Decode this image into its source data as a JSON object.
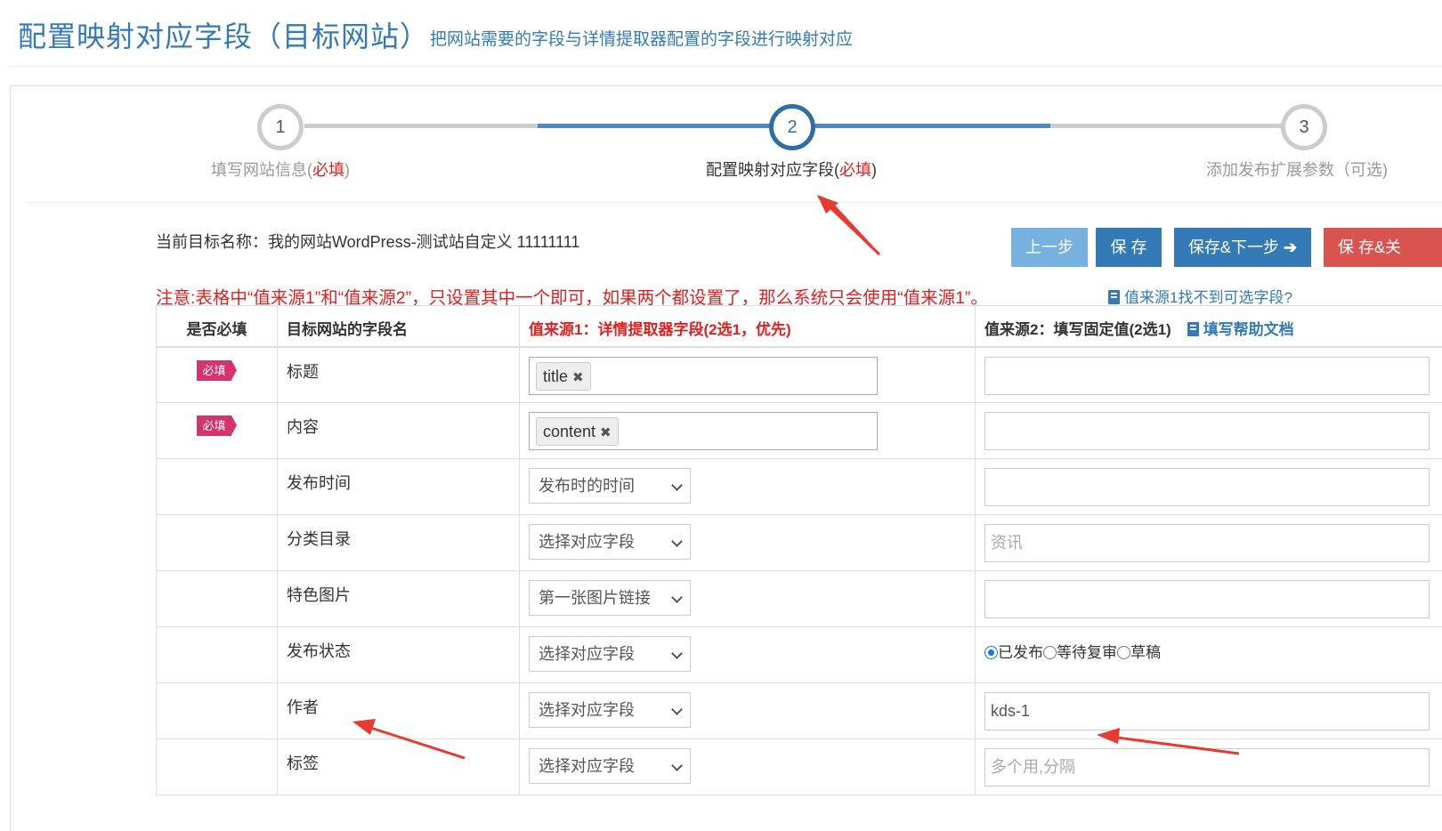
{
  "header": {
    "title": "配置映射对应字段（目标网站）",
    "subtitle": "把网站需要的字段与详情提取器配置的字段进行映射对应"
  },
  "wizard": {
    "steps": [
      {
        "number": "1",
        "label": "填写网站信息(",
        "req": "必填",
        "label_end": ")"
      },
      {
        "number": "2",
        "label": "配置映射对应字段(",
        "req": "必填",
        "label_end": ")"
      },
      {
        "number": "3",
        "label": "添加发布扩展参数（可选)",
        "req": "",
        "label_end": ""
      }
    ],
    "active_step": 2
  },
  "target_name": "当前目标名称：我的网站WordPress-测试站自定义 11111111",
  "buttons": {
    "prev": "上一步",
    "save": "保 存",
    "save_next": "保存&下一步",
    "save_close": "保 存&关"
  },
  "notice": "注意:表格中“值来源1”和“值来源2”，只设置其中一个即可，如果两个都设置了，那么系统只会使用“值来源1”。",
  "notice_link": "值来源1找不到可选字段?",
  "table": {
    "headers": {
      "required": "是否必填",
      "field_name": "目标网站的字段名",
      "source1": "值来源1：详情提取器字段(2选1，优先)",
      "source2": "值来源2：填写固定值(2选1)",
      "help": "填写帮助文档"
    },
    "required_badge": "必填",
    "rows": [
      {
        "name": "标题",
        "required": true,
        "src1_type": "tag",
        "src1_value": "title",
        "src2_type": "input",
        "src2_value": "",
        "src2_placeholder": ""
      },
      {
        "name": "内容",
        "required": true,
        "src1_type": "tag",
        "src1_value": "content",
        "src2_type": "input",
        "src2_value": "",
        "src2_placeholder": ""
      },
      {
        "name": "发布时间",
        "required": false,
        "src1_type": "select",
        "src1_value": "发布时的时间",
        "src2_type": "input",
        "src2_value": "",
        "src2_placeholder": ""
      },
      {
        "name": "分类目录",
        "required": false,
        "src1_type": "select",
        "src1_value": "选择对应字段",
        "src2_type": "input",
        "src2_value": "",
        "src2_placeholder": "资讯"
      },
      {
        "name": "特色图片",
        "required": false,
        "src1_type": "select",
        "src1_value": "第一张图片链接",
        "src2_type": "input",
        "src2_value": "",
        "src2_placeholder": ""
      },
      {
        "name": "发布状态",
        "required": false,
        "src1_type": "select",
        "src1_value": "选择对应字段",
        "src2_type": "radio",
        "radio_options": [
          "已发布",
          "等待复审",
          "草稿"
        ],
        "radio_selected": 0
      },
      {
        "name": "作者",
        "required": false,
        "src1_type": "select",
        "src1_value": "选择对应字段",
        "src2_type": "input",
        "src2_value": "kds-1",
        "src2_placeholder": ""
      },
      {
        "name": "标签",
        "required": false,
        "src1_type": "select",
        "src1_value": "选择对应字段",
        "src2_type": "input",
        "src2_value": "",
        "src2_placeholder": "多个用,分隔"
      }
    ]
  },
  "colors": {
    "primary": "#337ab7",
    "danger": "#d9534f",
    "required_badge": "#d6336c",
    "annotation_arrow": "#e83a2e"
  }
}
